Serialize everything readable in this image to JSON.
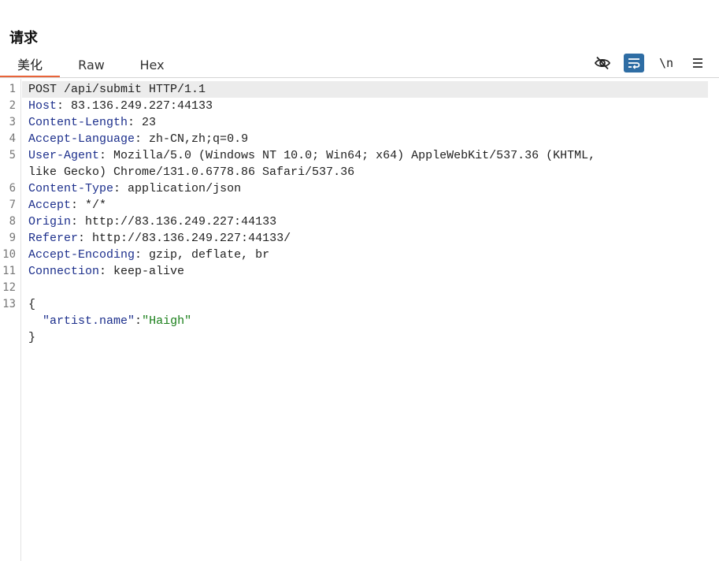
{
  "panel": {
    "title": "请求"
  },
  "tabs": [
    {
      "label": "美化",
      "active": true
    },
    {
      "label": "Raw",
      "active": false
    },
    {
      "label": "Hex",
      "active": false
    }
  ],
  "toolbar": {
    "hide_icon": "eye-off-icon",
    "wrap_icon": "word-wrap-icon",
    "newline_label": "\\n",
    "menu_icon": "hamburger-menu-icon"
  },
  "colors": {
    "accent": "#e8643a",
    "header_name": "#1c2f8c",
    "json_string": "#1a7f1a",
    "toggle_active": "#2e6da4"
  },
  "request": {
    "line_numbers": [
      "1",
      "2",
      "3",
      "4",
      "5",
      "6",
      "7",
      "8",
      "9",
      "10",
      "11",
      "12",
      "13"
    ],
    "request_line": "POST /api/submit HTTP/1.1",
    "headers": [
      {
        "name": "Host",
        "value": "83.136.249.227:44133"
      },
      {
        "name": "Content-Length",
        "value": "23"
      },
      {
        "name": "Accept-Language",
        "value": "zh-CN,zh;q=0.9"
      },
      {
        "name": "User-Agent",
        "value": "Mozilla/5.0 (Windows NT 10.0; Win64; x64) AppleWebKit/537.36 (KHTML,",
        "continuation": "like Gecko) Chrome/131.0.6778.86 Safari/537.36"
      },
      {
        "name": "Content-Type",
        "value": "application/json"
      },
      {
        "name": "Accept",
        "value": "*/*"
      },
      {
        "name": "Origin",
        "value": "http://83.136.249.227:44133"
      },
      {
        "name": "Referer",
        "value": "http://83.136.249.227:44133/"
      },
      {
        "name": "Accept-Encoding",
        "value": "gzip, deflate, br"
      },
      {
        "name": "Connection",
        "value": "keep-alive"
      }
    ],
    "body": {
      "open": "{",
      "key": "\"artist.name\"",
      "colon": ":",
      "value": "\"Haigh\"",
      "close": "}"
    }
  }
}
